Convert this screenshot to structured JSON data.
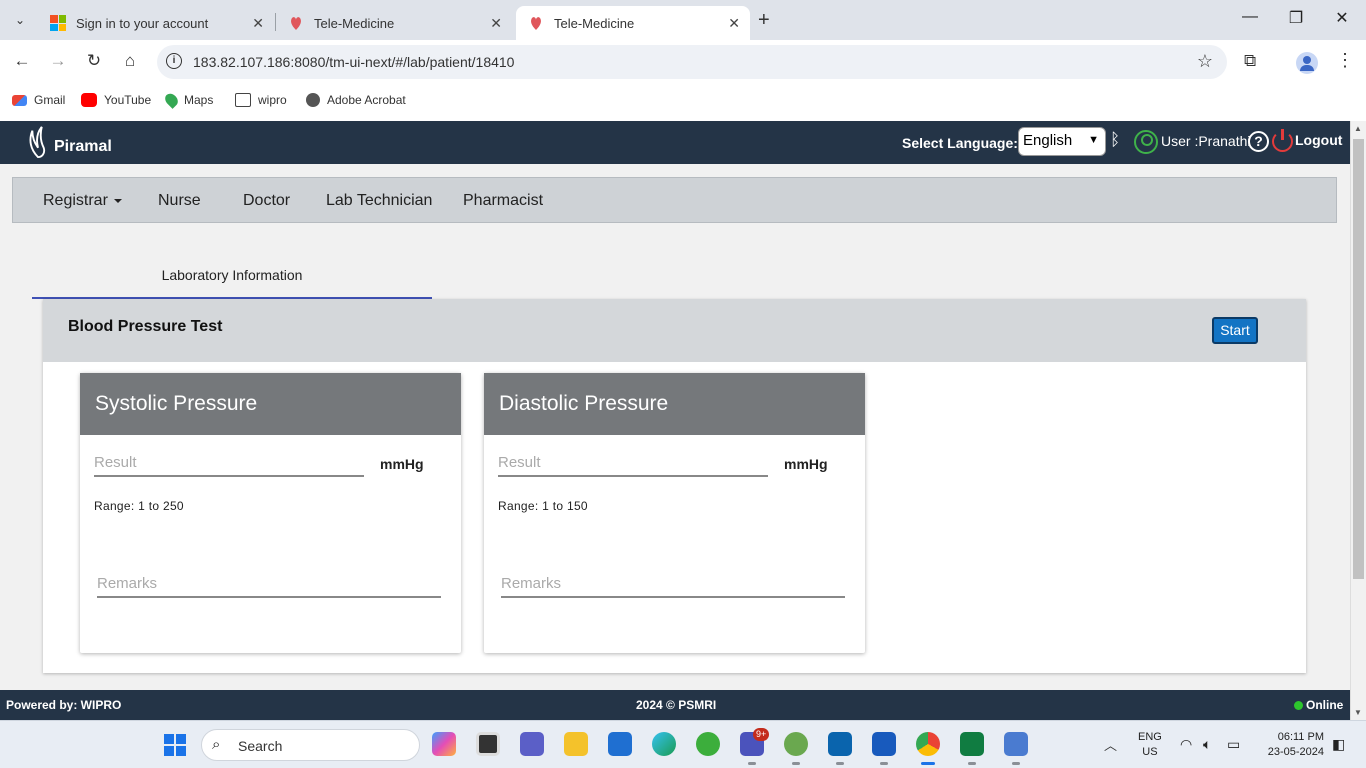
{
  "browser": {
    "tabs": [
      {
        "title": "Sign in to your account",
        "active": false
      },
      {
        "title": "Tele-Medicine",
        "active": false
      },
      {
        "title": "Tele-Medicine",
        "active": true
      }
    ],
    "url": "183.82.107.186:8080/tm-ui-next/#/lab/patient/18410",
    "bookmarks": [
      "Gmail",
      "YouTube",
      "Maps",
      "wipro",
      "Adobe Acrobat"
    ]
  },
  "header": {
    "brand": "Piramal",
    "language_label": "Select Language:",
    "language_value": "English",
    "user_text": "User :Pranathi",
    "logout_label": "Logout"
  },
  "roles": [
    "Registrar",
    "Nurse",
    "Doctor",
    "Lab Technician",
    "Pharmacist"
  ],
  "section_tab": "Laboratory Information",
  "test": {
    "title": "Blood Pressure Test",
    "start_label": "Start",
    "cards": [
      {
        "title": "Systolic Pressure",
        "result_placeholder": "Result",
        "unit": "mmHg",
        "range": "Range: 1 to 250",
        "remarks_placeholder": "Remarks"
      },
      {
        "title": "Diastolic Pressure",
        "result_placeholder": "Result",
        "unit": "mmHg",
        "range": "Range: 1 to 150",
        "remarks_placeholder": "Remarks"
      }
    ]
  },
  "footer": {
    "powered_by": "Powered by: WIPRO",
    "copyright": "2024 © PSMRI",
    "status": "Online"
  },
  "taskbar": {
    "search_label": "Search",
    "teams_badge": "9+",
    "lang_line1": "ENG",
    "lang_line2": "US",
    "time": "06:11 PM",
    "date": "23-05-2024"
  },
  "colors": {
    "header_bg": "#243447",
    "start_button": "#1374c4",
    "card_header": "#75787b",
    "online": "#2dc52d"
  }
}
